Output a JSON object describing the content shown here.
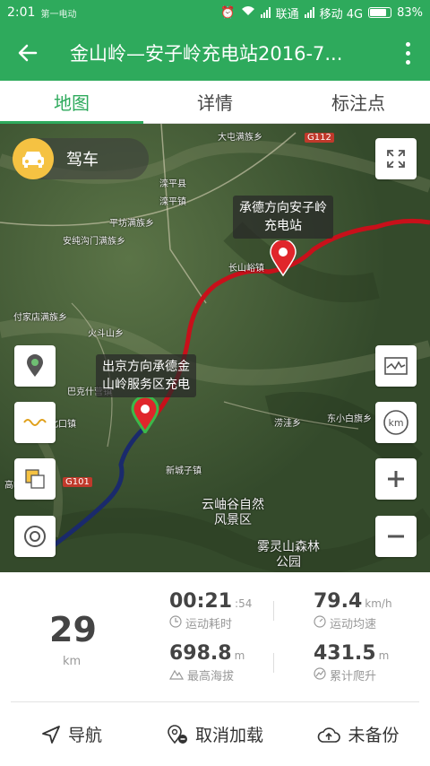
{
  "status_bar": {
    "time": "2:01",
    "watermark": "第一电动",
    "carrier1": "联通",
    "carrier2": "移动 4G",
    "battery": "83%",
    "battery_level": 0.83
  },
  "app_bar": {
    "title": "金山岭—安子岭充电站2016-7..."
  },
  "tabs": [
    {
      "label": "地图"
    },
    {
      "label": "详情"
    },
    {
      "label": "标注点"
    }
  ],
  "map": {
    "drive_mode": "驾车",
    "callouts": {
      "end": "承德方向安子岭\n充电站",
      "start": "出京方向承德金\n山岭服务区充电"
    },
    "places": {
      "p1": "大屯满族乡",
      "p2": "滦平县",
      "p3": "滦平镇",
      "p4": "平坊满族乡",
      "p5": "安纯沟门满族乡",
      "p6": "付家店满族乡",
      "p7": "火斗山乡",
      "p8": "巴克什营镇",
      "p9": "古北口镇",
      "p10": "高岭镇",
      "p11": "涝洼乡",
      "p12": "东小白旗乡",
      "p13": "新城子镇",
      "p14": "云岫谷自然风景区",
      "p15": "雾灵山森林公园",
      "p16": "长山峪镇"
    },
    "roads": {
      "g112": "G112",
      "g101": "G101"
    }
  },
  "stats": {
    "distance": "29",
    "distance_unit": "km",
    "duration_main": "00:21",
    "duration_sec": ":54",
    "duration_label": "运动耗时",
    "speed": "79.4",
    "speed_unit": "km/h",
    "speed_label": "运动均速",
    "altitude": "698.8",
    "altitude_unit": "m",
    "altitude_label": "最高海拔",
    "climb": "431.5",
    "climb_unit": "m",
    "climb_label": "累计爬升"
  },
  "actions": [
    {
      "label": "导航"
    },
    {
      "label": "取消加载"
    },
    {
      "label": "未备份"
    }
  ],
  "colors": {
    "primary": "#2eaa5c",
    "route_red": "#c8101a",
    "route_dark": "#1a2a6c",
    "drive_chip": "#f5c242"
  }
}
